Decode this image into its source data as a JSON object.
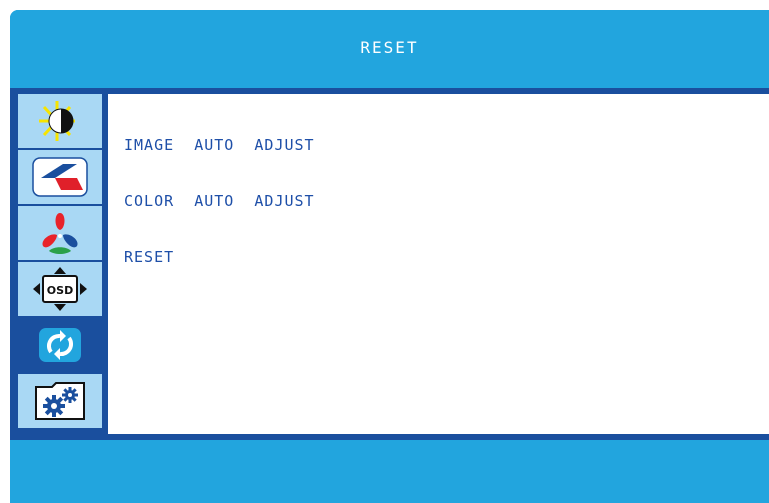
{
  "osd": {
    "title": "RESET",
    "colors": {
      "accent": "#22a5de",
      "frame": "#1a4f9e",
      "sidebar_item": "#a9d8f4",
      "text": "#1e4fa8"
    },
    "sidebar": {
      "items": [
        {
          "icon": "brightness-contrast-icon",
          "active": false
        },
        {
          "icon": "image-geometry-icon",
          "active": false
        },
        {
          "icon": "color-icon",
          "active": false
        },
        {
          "icon": "osd-settings-icon",
          "active": false
        },
        {
          "icon": "reset-icon",
          "active": true
        },
        {
          "icon": "misc-settings-icon",
          "active": false
        }
      ]
    },
    "menu": {
      "items": [
        {
          "label": "IMAGE  AUTO  ADJUST"
        },
        {
          "label": "COLOR  AUTO  ADJUST"
        },
        {
          "label": "RESET"
        }
      ]
    }
  }
}
